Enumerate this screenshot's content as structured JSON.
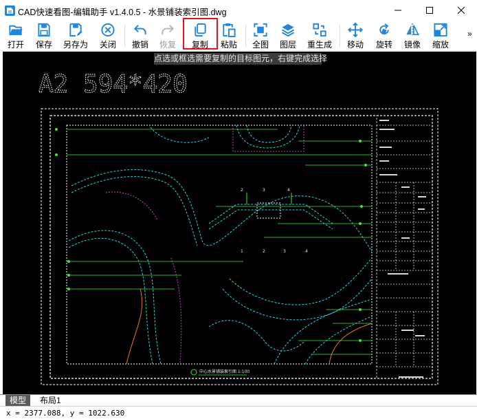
{
  "window": {
    "title": "CAD快速看图-编辑助手 v1.4.0.5 - 水景铺装索引图.dwg"
  },
  "toolbar": {
    "items": [
      {
        "label": "打开",
        "icon": "folder-open-icon"
      },
      {
        "label": "保存",
        "icon": "save-icon"
      },
      {
        "label": "另存为",
        "icon": "save-as-icon"
      },
      {
        "label": "关闭",
        "icon": "close-circle-icon"
      },
      {
        "label": "撤销",
        "icon": "undo-icon"
      },
      {
        "label": "恢复",
        "icon": "redo-icon",
        "disabled": true
      },
      {
        "label": "复制",
        "icon": "copy-icon",
        "highlighted": true
      },
      {
        "label": "粘贴",
        "icon": "paste-icon"
      },
      {
        "label": "全图",
        "icon": "fit-view-icon"
      },
      {
        "label": "图层",
        "icon": "layers-icon"
      },
      {
        "label": "重生成",
        "icon": "regenerate-icon"
      },
      {
        "label": "移动",
        "icon": "move-icon"
      },
      {
        "label": "旋转",
        "icon": "rotate-icon"
      },
      {
        "label": "镜像",
        "icon": "mirror-icon"
      },
      {
        "label": "缩放",
        "icon": "scale-icon"
      }
    ],
    "overflow": "»"
  },
  "tooltip": "点选或框选需要复制的目标图元，右键完成选择",
  "drawing": {
    "sheet_label": "A2 594*420",
    "plan_title": "中心水景铺装索引图 1:100",
    "callouts": [
      "2",
      "3",
      "4",
      "1",
      "2",
      "3",
      "4"
    ]
  },
  "layout_tabs": [
    {
      "label": "模型",
      "active": true
    },
    {
      "label": "布局1",
      "active": false
    }
  ],
  "status": {
    "coordinates": "x = 2377.088, y = 1022.630"
  },
  "colors": {
    "accent": "#1f86d9",
    "highlight": "#e8111a",
    "canvas": "#000000"
  }
}
